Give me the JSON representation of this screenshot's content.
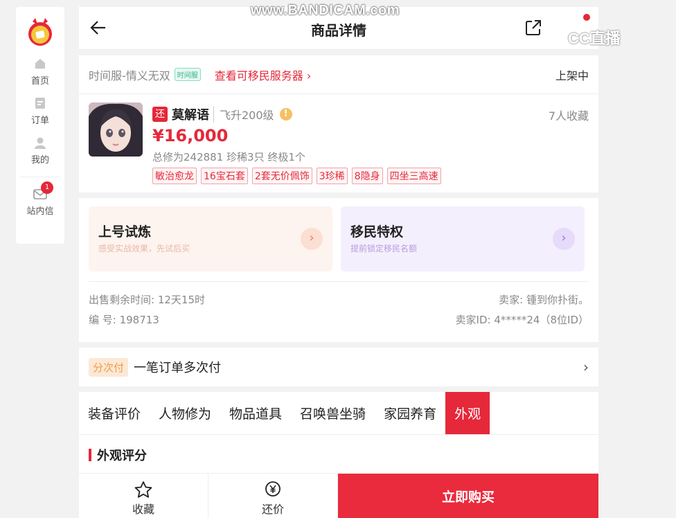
{
  "watermark": "www.BANDICAM.com",
  "cc_logo": "CC直播",
  "sidebar": {
    "items": [
      {
        "label": "首页",
        "icon": "home-icon"
      },
      {
        "label": "订单",
        "icon": "order-icon"
      },
      {
        "label": "我的",
        "icon": "user-icon"
      },
      {
        "label": "站内信",
        "icon": "mail-icon",
        "badge": "1"
      }
    ]
  },
  "header": {
    "title": "商品详情"
  },
  "server": {
    "name": "时间服-情义无双",
    "tag": "时间服",
    "link": "查看可移民服务器 ›",
    "status": "上架中"
  },
  "role": {
    "return_tag": "还",
    "name": "莫解语",
    "level": "飞升200级",
    "warn": "!",
    "favorites": "7人收藏",
    "price": "¥16,000",
    "stats": "总修为242881  珍稀3只  终极1个",
    "tags": [
      "敏治愈龙",
      "16宝石套",
      "2套无价佩饰",
      "3珍稀",
      "8隐身",
      "四坐三高速"
    ]
  },
  "promos": [
    {
      "title": "上号试炼",
      "subtitle": "感受实战效果，先试后买"
    },
    {
      "title": "移民特权",
      "subtitle": "提前锁定移民名额"
    }
  ],
  "info": {
    "remain": "出售剩余时间: 12天15时",
    "seller": "卖家: 锺到你扑街。",
    "code": "编 号: 198713",
    "seller_id": "卖家ID: 4*****24（8位ID）"
  },
  "installment": {
    "tag": "分次付",
    "text": "一笔订单多次付",
    "arrow": "›"
  },
  "tabs": [
    "装备评价",
    "人物修为",
    "物品道具",
    "召唤兽坐骑",
    "家园养育",
    "外观"
  ],
  "active_tab": "外观",
  "section_title": "外观评分",
  "bottom": {
    "favorite": "收藏",
    "bargain": "还价",
    "buy": "立即购买"
  },
  "colors": {
    "accent": "#e5283a",
    "price": "#e5283a",
    "installment_tag": "#ef9b45"
  }
}
